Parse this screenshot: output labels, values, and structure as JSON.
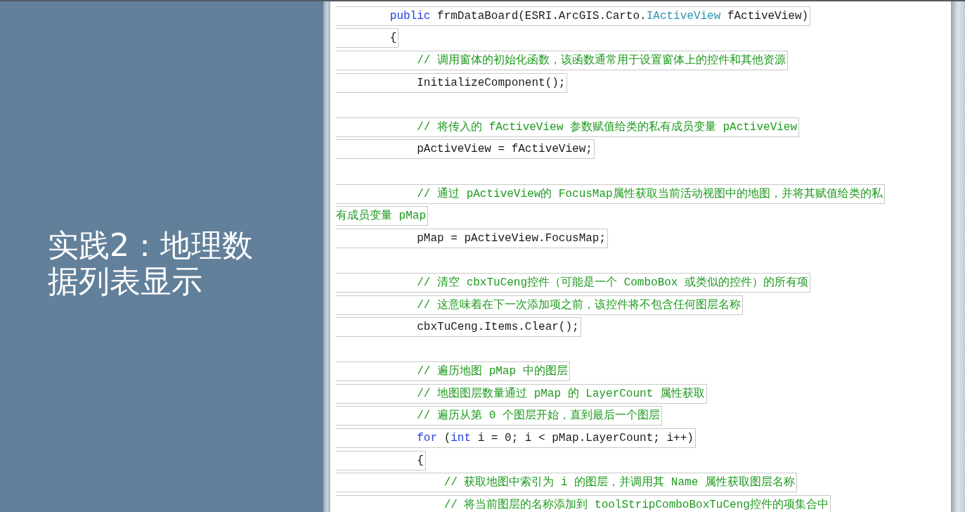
{
  "slide": {
    "title": "实践2：地理数据列表显示"
  },
  "code_lines": [
    {
      "kind": "code",
      "segments": [
        {
          "kind": "keyword",
          "text": "        public"
        },
        {
          "kind": "plain",
          "text": " frmDataBoard(ESRI.ArcGIS.Carto."
        },
        {
          "kind": "type",
          "text": "IActiveView"
        },
        {
          "kind": "plain",
          "text": " fActiveView)"
        }
      ]
    },
    {
      "kind": "code",
      "segments": [
        {
          "kind": "plain",
          "text": "        {"
        }
      ]
    },
    {
      "kind": "code",
      "segments": [
        {
          "kind": "comment",
          "text": "            // 调用窗体的初始化函数，该函数通常用于设置窗体上的控件和其他资源"
        }
      ]
    },
    {
      "kind": "code",
      "segments": [
        {
          "kind": "plain",
          "text": "            InitializeComponent();"
        }
      ]
    },
    {
      "kind": "blank"
    },
    {
      "kind": "code",
      "segments": [
        {
          "kind": "comment",
          "text": "            // 将传入的 fActiveView 参数赋值给类的私有成员变量 pActiveView"
        }
      ]
    },
    {
      "kind": "code",
      "segments": [
        {
          "kind": "plain",
          "text": "            pActiveView = fActiveView;"
        }
      ]
    },
    {
      "kind": "blank"
    },
    {
      "kind": "code",
      "segments": [
        {
          "kind": "comment",
          "text": "            // 通过 pActiveView的 FocusMap属性获取当前活动视图中的地图，并将其赋值给类的私"
        }
      ]
    },
    {
      "kind": "code",
      "segments": [
        {
          "kind": "comment",
          "text": "有成员变量 pMap"
        }
      ]
    },
    {
      "kind": "code",
      "segments": [
        {
          "kind": "plain",
          "text": "            pMap = pActiveView.FocusMap;"
        }
      ]
    },
    {
      "kind": "blank"
    },
    {
      "kind": "code",
      "segments": [
        {
          "kind": "comment",
          "text": "            // 清空 cbxTuCeng控件（可能是一个 ComboBox 或类似的控件）的所有项"
        }
      ]
    },
    {
      "kind": "code",
      "segments": [
        {
          "kind": "comment",
          "text": "            // 这意味着在下一次添加项之前，该控件将不包含任何图层名称"
        }
      ]
    },
    {
      "kind": "code",
      "segments": [
        {
          "kind": "plain",
          "text": "            cbxTuCeng.Items.Clear();"
        }
      ]
    },
    {
      "kind": "blank"
    },
    {
      "kind": "code",
      "segments": [
        {
          "kind": "comment",
          "text": "            // 遍历地图 pMap 中的图层"
        }
      ]
    },
    {
      "kind": "code",
      "segments": [
        {
          "kind": "comment",
          "text": "            // 地图图层数量通过 pMap 的 LayerCount 属性获取"
        }
      ]
    },
    {
      "kind": "code",
      "segments": [
        {
          "kind": "comment",
          "text": "            // 遍历从第 0 个图层开始，直到最后一个图层"
        }
      ]
    },
    {
      "kind": "code",
      "segments": [
        {
          "kind": "keyword",
          "text": "            for"
        },
        {
          "kind": "plain",
          "text": " ("
        },
        {
          "kind": "keyword",
          "text": "int"
        },
        {
          "kind": "plain",
          "text": " i = 0; i < pMap.LayerCount; i++)"
        }
      ]
    },
    {
      "kind": "code",
      "segments": [
        {
          "kind": "plain",
          "text": "            {"
        }
      ]
    },
    {
      "kind": "code",
      "segments": [
        {
          "kind": "comment",
          "text": "                // 获取地图中索引为 i 的图层，并调用其 Name 属性获取图层名称"
        }
      ]
    },
    {
      "kind": "code",
      "segments": [
        {
          "kind": "comment",
          "text": "                // 将当前图层的名称添加到 toolStripComboBoxTuCeng控件的项集合中"
        }
      ]
    }
  ]
}
